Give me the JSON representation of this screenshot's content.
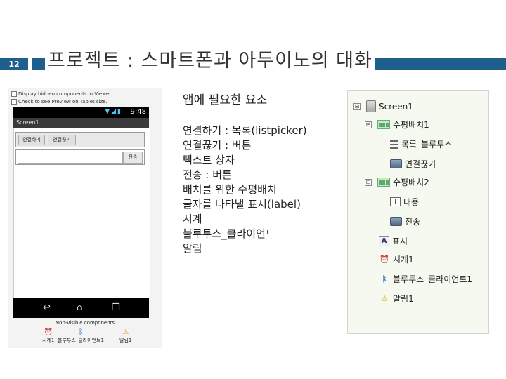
{
  "slide": {
    "number": "12",
    "title": "프로젝트 : 스마트폰과 아두이노의 대화"
  },
  "viewer": {
    "checkbox_hidden": "Display hidden components in Viewer",
    "checkbox_tablet": "Check to see Preview on Tablet size.",
    "status_time": "9:48",
    "screen_title": "Screen1",
    "button_connect": "연결하기",
    "button_disconnect": "연결끊기",
    "button_send": "전송",
    "nonvisible_label": "Non-visible components",
    "nonvisible": [
      {
        "label": "시계1",
        "icon": "clock-icon"
      },
      {
        "label": "블루투스_클라이언트1",
        "icon": "bluetooth-icon"
      },
      {
        "label": "알림1",
        "icon": "warning-icon"
      }
    ]
  },
  "requirements": {
    "heading": "앱에 필요한 요소",
    "items": [
      "연결하기 : 목록(listpicker)",
      "연결끊기 : 버튼",
      "텍스트 상자",
      "전송 : 버튼",
      "배치를 위한 수평배치",
      "글자를 나타낼 표시(label)",
      "시계",
      "블루투스_클라이언트",
      "알림"
    ]
  },
  "components": {
    "screen": "Screen1",
    "arrangement1": "수평배치1",
    "listpicker": "목록_블루투스",
    "disconnect": "연결끊기",
    "arrangement2": "수평배치2",
    "textbox": "내용",
    "send": "전송",
    "label": "표시",
    "clock": "시계1",
    "bluetooth": "블루투스_클라이언트1",
    "notifier": "알림1",
    "collapse_symbol": "⊟"
  }
}
